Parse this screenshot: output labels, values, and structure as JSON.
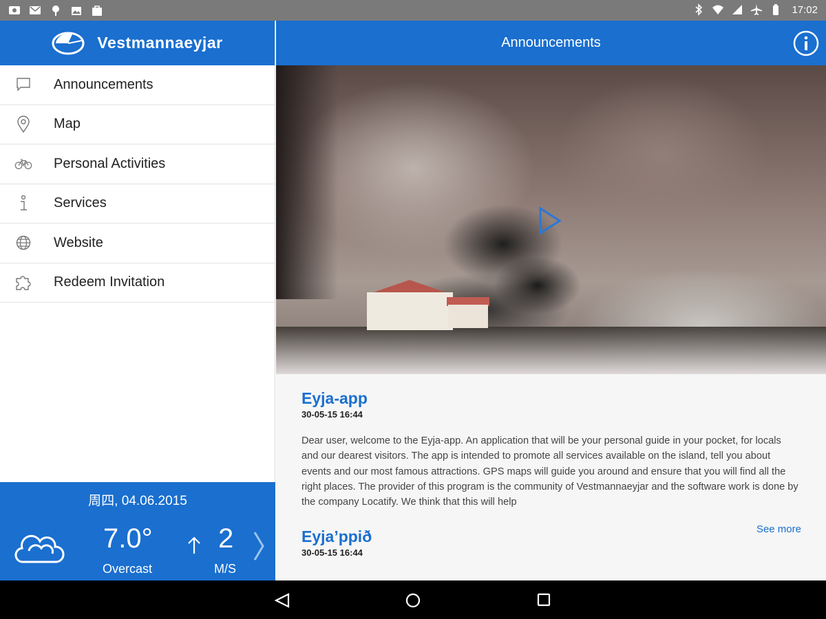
{
  "status_bar": {
    "time": "17:02",
    "left_icons": [
      "cast-icon",
      "email-icon",
      "location-pin-icon",
      "photo-icon",
      "shopping-bag-icon"
    ],
    "right_icons": [
      "bluetooth-icon",
      "wifi-icon",
      "signal-icon",
      "airplane-icon",
      "battery-icon"
    ]
  },
  "sidebar": {
    "app_title": "Vestmannaeyjar",
    "items": [
      {
        "label": "Announcements",
        "icon": "speech-bubble-icon"
      },
      {
        "label": "Map",
        "icon": "map-pin-icon"
      },
      {
        "label": "Personal Activities",
        "icon": "bicycle-icon"
      },
      {
        "label": "Services",
        "icon": "info-person-icon"
      },
      {
        "label": "Website",
        "icon": "globe-icon"
      },
      {
        "label": "Redeem Invitation",
        "icon": "puzzle-icon"
      }
    ]
  },
  "weather": {
    "date": "周四, 04.06.2015",
    "temperature": "7.0°",
    "condition": "Overcast",
    "wind_speed": "2",
    "wind_unit": "M/S"
  },
  "main": {
    "header_title": "Announcements",
    "articles": [
      {
        "title": "Eyja-app",
        "date": "30-05-15 16:44",
        "body": "Dear user, welcome to the Eyja-app. An application that will be your personal guide in your pocket, for locals and our dearest visitors. The app is intended to promote all services available on the island, tell you about events and our most famous attractions. GPS maps will guide you around and ensure that you will find all the right places. The provider of this program is the community of Vestmannaeyjar and the software work is done by the company Locatify. We think that this will help",
        "see_more": "See more"
      },
      {
        "title": "Eyja’ppið",
        "date": "30-05-15 16:44"
      }
    ]
  },
  "colors": {
    "brand_blue": "#1a6fcf",
    "status_bar_gray": "#7a7a7a"
  }
}
